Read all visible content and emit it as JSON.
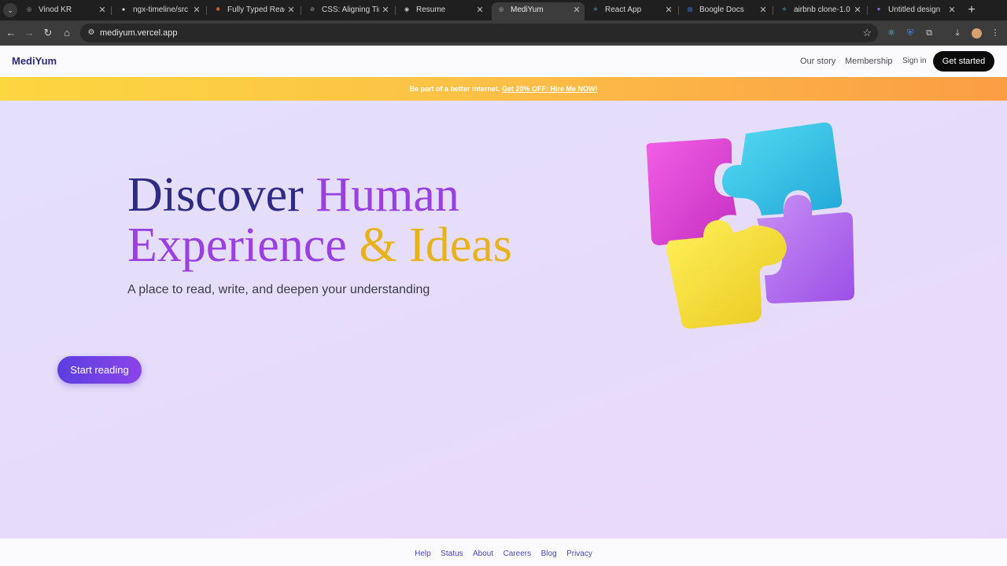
{
  "browser": {
    "tabs": [
      {
        "title": "Vinod KR",
        "icon": "globe-icon",
        "color": "#8a8a8a",
        "glyph": "◎"
      },
      {
        "title": "ngx-timeline/src",
        "icon": "github-icon",
        "color": "#ffffff",
        "glyph": "●"
      },
      {
        "title": "Fully Typed Reac",
        "icon": "react-burst-icon",
        "color": "#e06a2c",
        "glyph": "✺"
      },
      {
        "title": "CSS: Aligning Tir",
        "icon": "link-icon",
        "color": "#9c9c9c",
        "glyph": "⊘"
      },
      {
        "title": "Resume",
        "icon": "globe-icon",
        "color": "#8a8a8a",
        "glyph": "◉"
      },
      {
        "title": "MediYum",
        "icon": "globe-icon",
        "color": "#8a8a8a",
        "glyph": "◎"
      },
      {
        "title": "React App",
        "icon": "react-icon",
        "color": "#5fcde8",
        "glyph": "⚛"
      },
      {
        "title": "Boogle Docs",
        "icon": "docs-icon",
        "color": "#3b82f6",
        "glyph": "▤"
      },
      {
        "title": "airbnb clone-1.0",
        "icon": "react-icon",
        "color": "#5fcde8",
        "glyph": "⚛"
      },
      {
        "title": "Untitled design",
        "icon": "canva-heart-icon",
        "color": "#7b5cf0",
        "glyph": "♥"
      }
    ],
    "url": "mediyum.vercel.app"
  },
  "site": {
    "logo": "MediYum",
    "nav": {
      "our_story": "Our story",
      "membership": "Membership",
      "sign_in": "Sign in",
      "get_started": "Get started"
    },
    "promo": {
      "text": "Be part of a better internet.",
      "link": "Get 20% OFF: Hire Me NOW!"
    },
    "hero": {
      "title_part1": "Discover",
      "title_part2": "Human",
      "title_part3": "Experience",
      "title_part4": "& Ideas",
      "subtitle": "A place to read, write, and deepen your understanding",
      "cta": "Start reading"
    },
    "footer": {
      "links": [
        "Help",
        "Status",
        "About",
        "Careers",
        "Blog",
        "Privacy"
      ]
    }
  },
  "colors": {
    "brand": "#2d2b7c",
    "accent_purple": "#9a40e0",
    "accent_yellow": "#e7b21a",
    "promo_start": "#fbd740",
    "promo_end": "#fb9d45"
  }
}
